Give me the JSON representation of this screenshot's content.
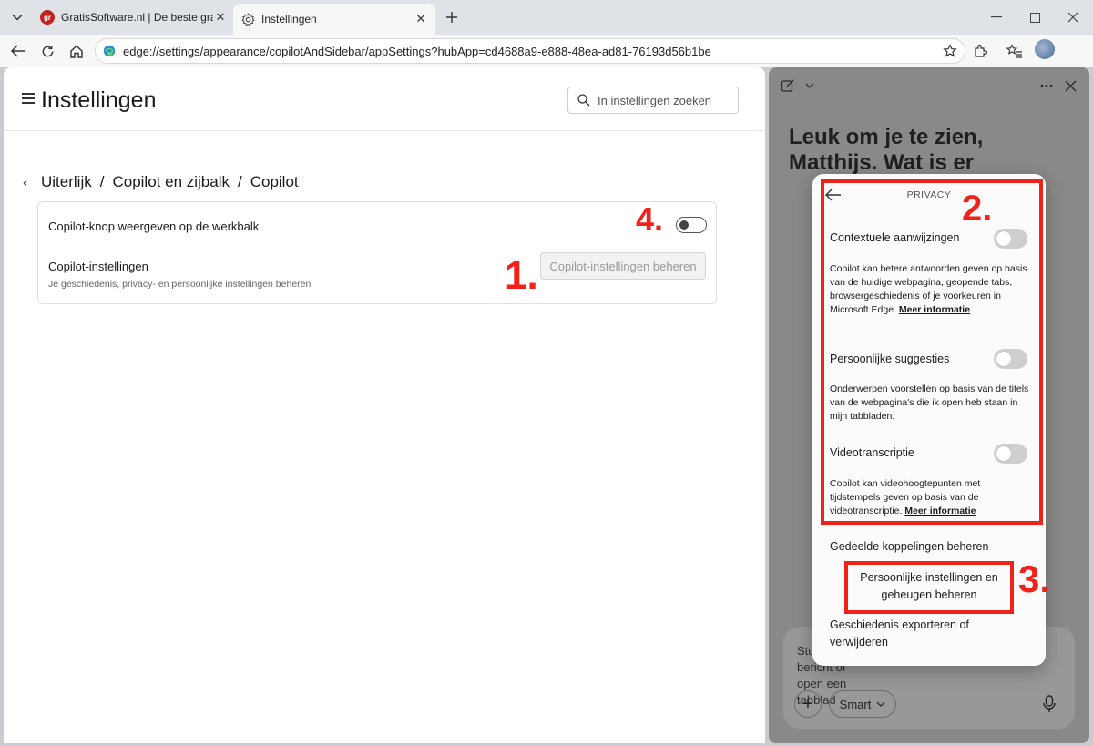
{
  "browser": {
    "tabs": [
      {
        "title": "GratisSoftware.nl | De beste gratis",
        "favicon": "gratissoftware-favicon"
      },
      {
        "title": "Instellingen",
        "favicon": "settings-gear-icon"
      }
    ],
    "url": "edge://settings/appearance/copilotAndSidebar/appSettings?hubApp=cd4688a9-e888-48ea-ad81-76193d56b1be"
  },
  "settings": {
    "title": "Instellingen",
    "search_placeholder": "In instellingen zoeken",
    "breadcrumb": [
      "Uiterlijk",
      "Copilot en zijbalk",
      "Copilot"
    ],
    "breadcrumb_sep": "/",
    "show_button_label": "Copilot-knop weergeven op de werkbalk",
    "show_button_on": false,
    "copilot_settings_label": "Copilot-instellingen",
    "copilot_settings_sub": "Je geschiedenis, privacy- en persoonlijke instellingen beheren",
    "manage_button": "Copilot-instellingen beheren"
  },
  "annotations": {
    "one": "1.",
    "two": "2.",
    "three": "3.",
    "four": "4.",
    "color": "#f0221a"
  },
  "copilot": {
    "greeting": "Leuk om je te zien, Matthijs. Wat is er",
    "input_placeholder": "Stuur een bericht of open een tabblad",
    "smart_label": "Smart",
    "plus_label": "+"
  },
  "privacy": {
    "heading": "PRIVACY",
    "items": [
      {
        "label": "Contextuele aanwijzingen",
        "on": false,
        "desc": "Copilot kan betere antwoorden geven op basis van de huidige webpagina, geopende tabs, browsergeschiedenis of je voorkeuren in Microsoft Edge.",
        "link": "Meer informatie"
      },
      {
        "label": "Persoonlijke suggesties",
        "on": false,
        "desc": "Onderwerpen voorstellen op basis van de titels van de webpagina's die ik open heb staan in mijn tabbladen.",
        "link": ""
      },
      {
        "label": "Videotranscriptie",
        "on": false,
        "desc": "Copilot kan videohoogtepunten met tijdstempels geven op basis van de videotranscriptie.",
        "link": "Meer informatie"
      }
    ],
    "shared_links": "Gedeelde koppelingen beheren",
    "personal_memory": "Persoonlijke instellingen en geheugen beheren",
    "export_history": "Geschiedenis exporteren of verwijderen"
  }
}
